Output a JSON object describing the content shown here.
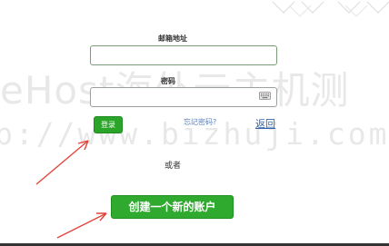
{
  "watermark": {
    "line1": "eHost海外云主机测",
    "line2": "p://www.bizhuji.com"
  },
  "form": {
    "email_label": "邮箱地址",
    "email_value": "",
    "password_label": "密码",
    "password_value": "",
    "login_label": "登录",
    "forgot_label": "忘记密码?",
    "back_label": "返回",
    "or_label": "或者",
    "create_account_label": "创建一个新的账户"
  },
  "icons": {
    "keyboard": "keyboard-icon"
  },
  "colors": {
    "button_green": "#2aa52a",
    "link_blue": "#3366aa",
    "annotation_red": "#e0443a"
  }
}
